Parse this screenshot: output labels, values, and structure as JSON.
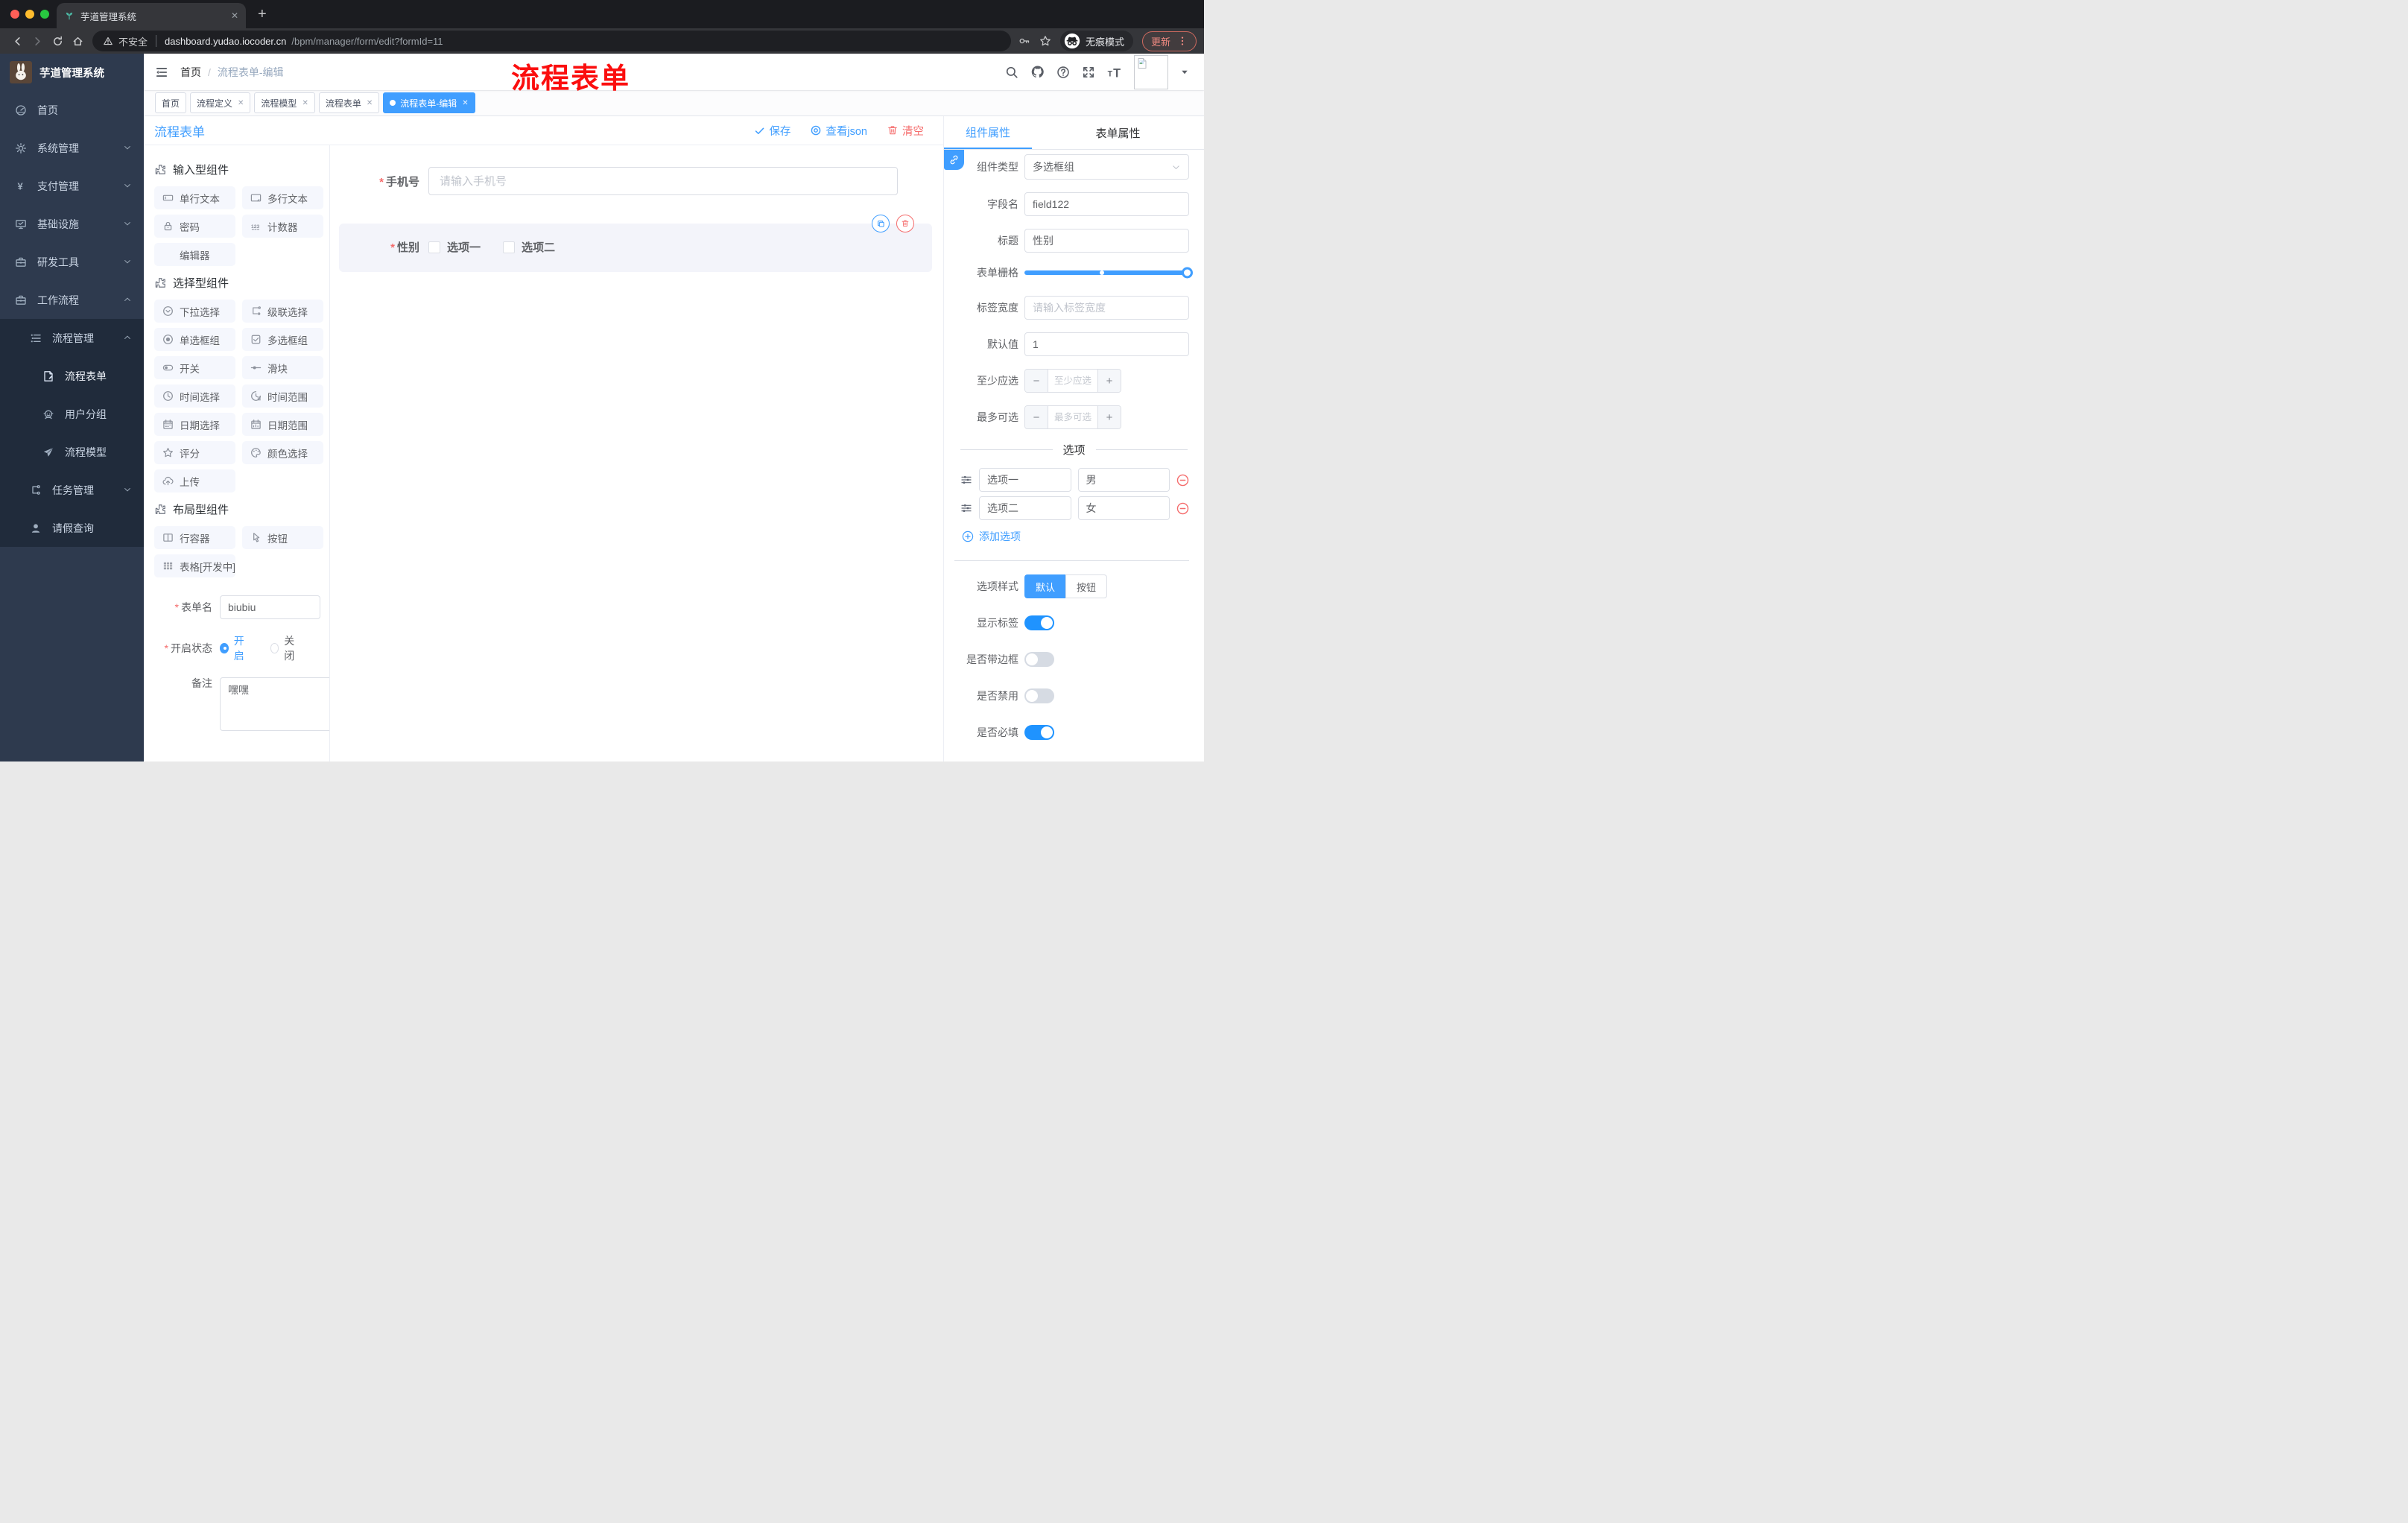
{
  "colors": {
    "accent": "#409eff",
    "danger": "#f56c6c",
    "red_title": "#fb0e0e",
    "sidebar_bg": "#2e3a4e",
    "submenu_bg": "#202b3b",
    "selected_field_bg": "#f3f4fa"
  },
  "browser": {
    "tab_title": "芋道管理系统",
    "url_security": "不安全",
    "url_host": "dashboard.yudao.iocoder.cn",
    "url_path": "/bpm/manager/form/edit?formId=11",
    "incognito_label": "无痕模式",
    "update_label": "更新"
  },
  "sidebar": {
    "logo_title": "芋道管理系统",
    "items": [
      {
        "label": "首页",
        "icon": "dashboard-icon",
        "indent": 1
      },
      {
        "label": "系统管理",
        "icon": "gear-icon",
        "chevron": "down",
        "indent": 1
      },
      {
        "label": "支付管理",
        "icon": "yen-icon",
        "chevron": "down",
        "indent": 1
      },
      {
        "label": "基础设施",
        "icon": "monitor-icon",
        "chevron": "down",
        "indent": 1
      },
      {
        "label": "研发工具",
        "icon": "toolbox-icon",
        "chevron": "down",
        "indent": 1
      },
      {
        "label": "工作流程",
        "icon": "toolbox-icon",
        "chevron": "up",
        "indent": 1
      },
      {
        "label": "流程管理",
        "icon": "flow-list-icon",
        "chevron": "up",
        "indent": 2,
        "submenu": true
      },
      {
        "label": "流程表单",
        "icon": "form-doc-icon",
        "indent": 3,
        "submenu": true,
        "highlight": true
      },
      {
        "label": "用户分组",
        "icon": "user-group-icon",
        "indent": 3,
        "submenu": true
      },
      {
        "label": "流程模型",
        "icon": "send-icon",
        "indent": 3,
        "submenu": true
      },
      {
        "label": "任务管理",
        "icon": "tree-icon",
        "chevron": "down",
        "indent": 2,
        "submenu": true
      },
      {
        "label": "请假查询",
        "icon": "user-icon",
        "indent": 2,
        "submenu": true
      }
    ]
  },
  "header": {
    "breadcrumb": {
      "home": "首页",
      "current": "流程表单-编辑"
    },
    "watermark": "流程表单"
  },
  "tabs": [
    {
      "label": "首页",
      "closable": false,
      "active": false
    },
    {
      "label": "流程定义",
      "closable": true,
      "active": false
    },
    {
      "label": "流程模型",
      "closable": true,
      "active": false
    },
    {
      "label": "流程表单",
      "closable": true,
      "active": false
    },
    {
      "label": "流程表单-编辑",
      "closable": true,
      "active": true
    }
  ],
  "designer": {
    "title": "流程表单",
    "actions": {
      "save": "保存",
      "view_json": "查看json",
      "clear": "清空"
    }
  },
  "palette": {
    "sections": [
      {
        "title": "输入型组件",
        "items": [
          {
            "label": "单行文本",
            "icon": "input-icon"
          },
          {
            "label": "多行文本",
            "icon": "textarea-icon"
          },
          {
            "label": "密码",
            "icon": "lock-icon"
          },
          {
            "label": "计数器",
            "icon": "number-icon"
          },
          {
            "label": "编辑器",
            "icon": ""
          }
        ]
      },
      {
        "title": "选择型组件",
        "items": [
          {
            "label": "下拉选择",
            "icon": "select-icon"
          },
          {
            "label": "级联选择",
            "icon": "cascader-icon"
          },
          {
            "label": "单选框组",
            "icon": "radio-icon"
          },
          {
            "label": "多选框组",
            "icon": "checkbox-icon"
          },
          {
            "label": "开关",
            "icon": "switch-icon"
          },
          {
            "label": "滑块",
            "icon": "slider-icon"
          },
          {
            "label": "时间选择",
            "icon": "time-icon"
          },
          {
            "label": "时间范围",
            "icon": "time-range-icon"
          },
          {
            "label": "日期选择",
            "icon": "date-icon"
          },
          {
            "label": "日期范围",
            "icon": "date-range-icon"
          },
          {
            "label": "评分",
            "icon": "star-icon"
          },
          {
            "label": "颜色选择",
            "icon": "color-icon"
          },
          {
            "label": "上传",
            "icon": "upload-icon"
          }
        ]
      },
      {
        "title": "布局型组件",
        "items": [
          {
            "label": "行容器",
            "icon": "row-icon"
          },
          {
            "label": "按钮",
            "icon": "button-icon"
          },
          {
            "label": "表格[开发中]",
            "icon": "table-icon"
          }
        ]
      }
    ],
    "form": {
      "name_label": "表单名",
      "name_value": "biubiu",
      "status_label": "开启状态",
      "status_on": "开启",
      "status_off": "关闭",
      "remark_label": "备注",
      "remark_value": "嘿嘿"
    }
  },
  "canvas": {
    "fields": [
      {
        "label": "手机号",
        "required": true,
        "placeholder": "请输入手机号"
      },
      {
        "label": "性别",
        "required": true,
        "options": [
          "选项一",
          "选项二"
        ],
        "selected": true
      }
    ]
  },
  "inspector": {
    "tabs": [
      "组件属性",
      "表单属性"
    ],
    "rows": {
      "component_type": {
        "label": "组件类型",
        "value": "多选框组"
      },
      "field_name": {
        "label": "字段名",
        "value": "field122"
      },
      "title": {
        "label": "标题",
        "value": "性别"
      },
      "grid": {
        "label": "表单栅格"
      },
      "label_width": {
        "label": "标签宽度",
        "placeholder": "请输入标签宽度"
      },
      "default_value": {
        "label": "默认值",
        "value": "1"
      },
      "min_select": {
        "label": "至少应选",
        "placeholder": "至少应选"
      },
      "max_select": {
        "label": "最多可选",
        "placeholder": "最多可选"
      }
    },
    "options_divider": "选项",
    "options": [
      {
        "label": "选项一",
        "value": "男"
      },
      {
        "label": "选项二",
        "value": "女"
      }
    ],
    "add_option": "添加选项",
    "option_style": {
      "label": "选项样式",
      "choices": [
        "默认",
        "按钮"
      ],
      "active": "默认"
    },
    "switches": [
      {
        "label": "显示标签",
        "on": true
      },
      {
        "label": "是否带边框",
        "on": false
      },
      {
        "label": "是否禁用",
        "on": false
      },
      {
        "label": "是否必填",
        "on": true
      }
    ]
  }
}
